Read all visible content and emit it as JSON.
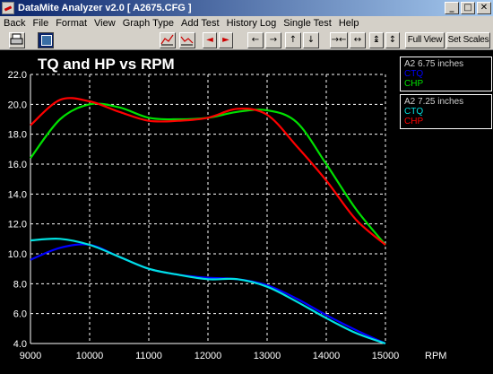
{
  "window": {
    "title": "DataMite Analyzer v2.0  [ A2675.CFG ]",
    "min_glyph": "_",
    "max_glyph": "□",
    "close_glyph": "✕"
  },
  "menu": [
    "Back",
    "File",
    "Format",
    "View",
    "Graph Type",
    "Add Test",
    "History Log",
    "Single Test",
    "Help"
  ],
  "toolbar": {
    "full_view": "Full View",
    "set_scales": "Set Scales",
    "left_arrow": "←",
    "right_arrow": "→",
    "up_arrow": "↑",
    "down_arrow": "↓",
    "red_left": "◄",
    "red_right": "►",
    "shrink_h": "→←",
    "expand_h": "↔",
    "shrink_v": "↨",
    "expand_v": "↕"
  },
  "colors": {
    "ctq_a": "#0000ff",
    "ctq_b": "#00e0e0",
    "chp_a": "#00e000",
    "chp_b": "#ff0000",
    "grid": "#ffffff",
    "axis": "#ffffff"
  },
  "legends": [
    {
      "title": "A2 6.75 inches",
      "entries": [
        {
          "label": "CTQ",
          "color": "#0000ff"
        },
        {
          "label": "CHP",
          "color": "#00e000"
        }
      ]
    },
    {
      "title": "A2 7.25 inches",
      "entries": [
        {
          "label": "CTQ",
          "color": "#00e0e0"
        },
        {
          "label": "CHP",
          "color": "#ff0000"
        }
      ]
    }
  ],
  "chart_data": {
    "type": "line",
    "title": "TQ and HP vs RPM",
    "xlabel": "RPM",
    "ylabel": "",
    "xlim": [
      9000,
      15000
    ],
    "ylim": [
      4.0,
      22.0
    ],
    "x_ticks": [
      "9000",
      "10000",
      "11000",
      "12000",
      "13000",
      "14000",
      "15000"
    ],
    "y_ticks": [
      "4.0",
      "6.0",
      "8.0",
      "10.0",
      "12.0",
      "14.0",
      "16.0",
      "18.0",
      "20.0",
      "22.0"
    ],
    "grid": true,
    "legend_placement": "right",
    "x": [
      9000,
      9500,
      10000,
      10500,
      11000,
      11500,
      12000,
      12500,
      13000,
      13500,
      14000,
      14500,
      15000
    ],
    "series": [
      {
        "name": "A2 6.75 inches CTQ",
        "color": "#0000ff",
        "values": [
          9.6,
          10.4,
          10.6,
          9.8,
          9.0,
          8.6,
          8.4,
          8.3,
          7.9,
          7.0,
          5.9,
          4.9,
          4.0
        ]
      },
      {
        "name": "A2 6.75 inches CHP",
        "color": "#00e000",
        "values": [
          16.4,
          19.0,
          20.0,
          19.8,
          19.1,
          19.0,
          19.1,
          19.5,
          19.6,
          18.8,
          16.0,
          13.0,
          10.6
        ]
      },
      {
        "name": "A2 7.25 inches CTQ",
        "color": "#00e0e0",
        "values": [
          10.9,
          11.0,
          10.6,
          9.8,
          9.0,
          8.6,
          8.3,
          8.3,
          7.8,
          6.8,
          5.7,
          4.7,
          4.0
        ]
      },
      {
        "name": "A2 7.25 inches CHP",
        "color": "#ff0000",
        "values": [
          18.6,
          20.3,
          20.2,
          19.5,
          18.9,
          18.9,
          19.1,
          19.7,
          19.3,
          17.2,
          14.9,
          12.3,
          10.6
        ]
      }
    ]
  }
}
